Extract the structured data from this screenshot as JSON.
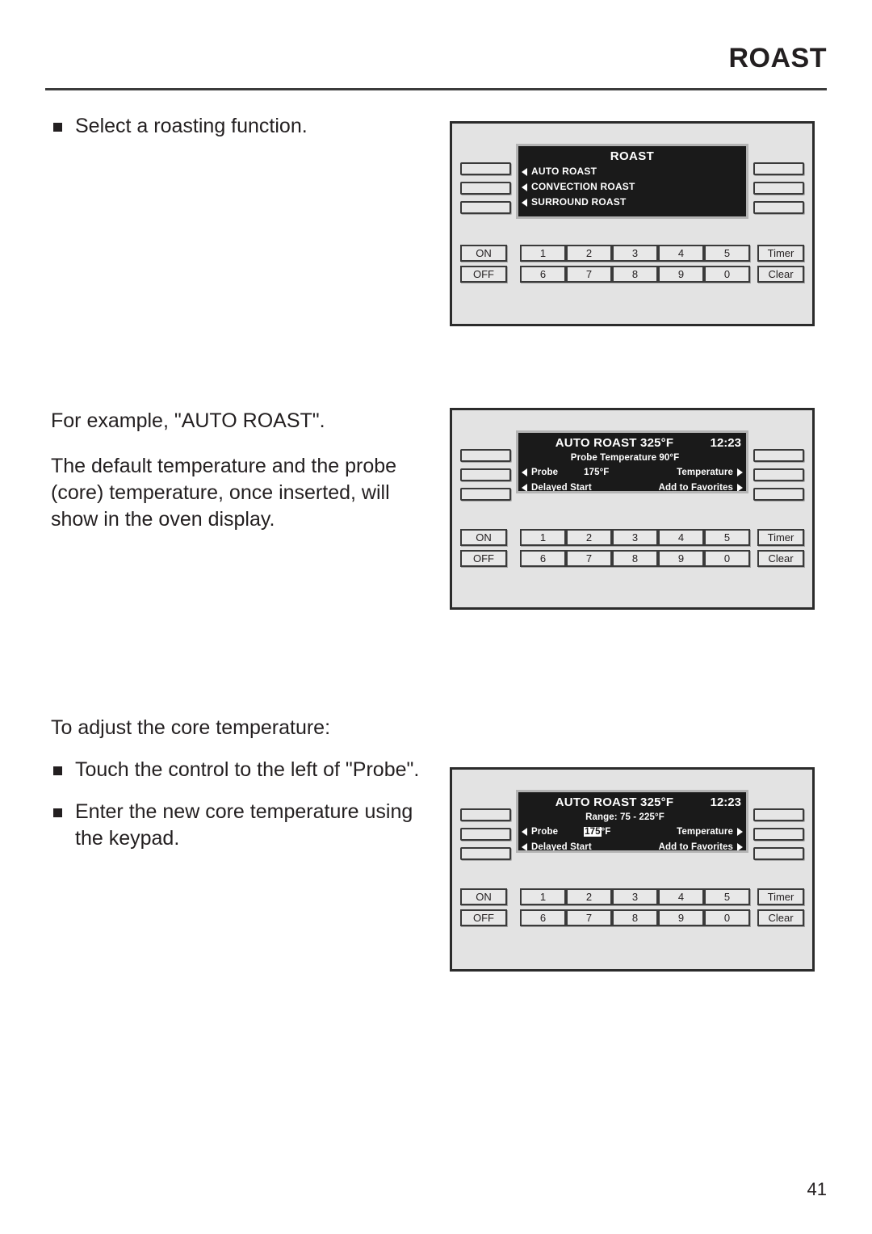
{
  "header": {
    "title": "ROAST"
  },
  "page_number": "41",
  "content": {
    "block1": {
      "bullet1": "Select a roasting function."
    },
    "block2": {
      "para1": "For example, \"AUTO ROAST\".",
      "para2": "The default temperature and the probe (core) temperature, once inserted, will show in the oven display."
    },
    "block3": {
      "intro": "To adjust the core temperature:",
      "bullet1": "Touch the control to the left of \"Probe\".",
      "bullet2": "Enter the new core temperature using the keypad."
    }
  },
  "keypad": {
    "on": "ON",
    "off": "OFF",
    "timer": "Timer",
    "clear": "Clear",
    "numbers_row1": [
      "1",
      "2",
      "3",
      "4",
      "5"
    ],
    "numbers_row2": [
      "6",
      "7",
      "8",
      "9",
      "0"
    ]
  },
  "panels": [
    {
      "id": "panel-roast-menu",
      "display": {
        "mode": "menu",
        "title": "ROAST",
        "items": [
          "AUTO ROAST",
          "CONVECTION ROAST",
          "SURROUND ROAST"
        ]
      }
    },
    {
      "id": "panel-auto-roast-status",
      "display": {
        "mode": "status",
        "title": "AUTO ROAST 325°F",
        "clock": "12:23",
        "subtitle": "Probe Temperature 90°F",
        "row1_left": "Probe",
        "row1_value": "175°F",
        "row1_value_highlighted": "",
        "row1_value_suffix": "",
        "row1_right": "Temperature",
        "row2_left": "Delayed Start",
        "row2_right": "Add to Favorites"
      }
    },
    {
      "id": "panel-auto-roast-edit",
      "display": {
        "mode": "status-edit",
        "title": "AUTO ROAST 325°F",
        "clock": "12:23",
        "subtitle": "Range: 75 - 225°F",
        "row1_left": "Probe",
        "row1_value_highlighted": "175",
        "row1_value_suffix": "°F",
        "row1_right": "Temperature",
        "row2_left": "Delayed Start",
        "row2_right": "Add to Favorites"
      }
    }
  ],
  "colors": {
    "ink": "#231f20",
    "panel_bg": "#e3e3e3",
    "display_bg": "#1a1a1a",
    "display_fg": "#ffffff",
    "bezel": "#b4b4b4"
  }
}
